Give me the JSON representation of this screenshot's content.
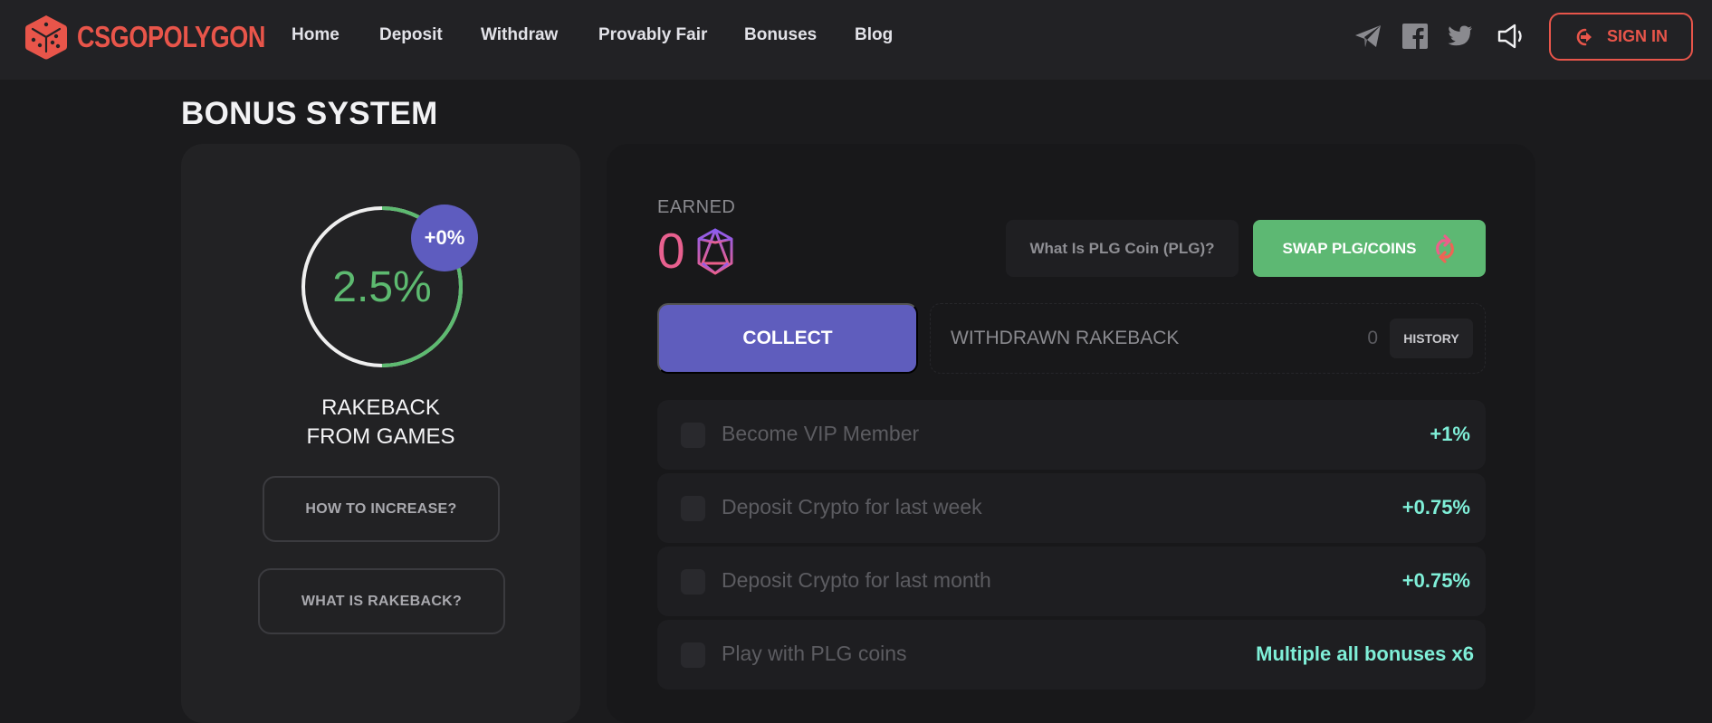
{
  "header": {
    "brand": "CSGOPOLYGON",
    "nav": [
      "Home",
      "Deposit",
      "Withdraw",
      "Provably Fair",
      "Bonuses",
      "Blog"
    ],
    "social_icons": [
      "telegram-icon",
      "facebook-icon",
      "twitter-icon",
      "sound-icon"
    ],
    "signin_label": "SIGN IN"
  },
  "page": {
    "title": "BONUS SYSTEM"
  },
  "rakeback": {
    "value": "2.5%",
    "ring_progress": 0.5,
    "bonus_badge": "+0%",
    "title_line1": "RAKEBACK",
    "title_line2": "FROM GAMES",
    "how_to_increase": "HOW TO INCREASE?",
    "what_is_rakeback": "WHAT IS RAKEBACK?"
  },
  "earned": {
    "label": "EARNED",
    "value": "0",
    "what_plg_label": "What Is PLG Coin (PLG)?",
    "swap_label": "SWAP PLG/COINS",
    "collect_label": "COLLECT",
    "withdrawn_label": "WITHDRAWN RAKEBACK",
    "withdrawn_value": "0",
    "history_label": "HISTORY"
  },
  "bonuses": [
    {
      "label": "Become VIP Member",
      "value": "+1%",
      "checked": false
    },
    {
      "label": "Deposit Crypto for last week",
      "value": "+0.75%",
      "checked": false
    },
    {
      "label": "Deposit Crypto for last month",
      "value": "+0.75%",
      "checked": false
    },
    {
      "label": "Play with PLG coins",
      "value": "Multiple all bonuses x6",
      "checked": false
    }
  ],
  "colors": {
    "brand": "#e8554a",
    "accent_purple": "#5f5dbd",
    "success_green": "#5db873",
    "bonus_teal": "#7fefd8",
    "earned_pink": "#e8608f"
  }
}
